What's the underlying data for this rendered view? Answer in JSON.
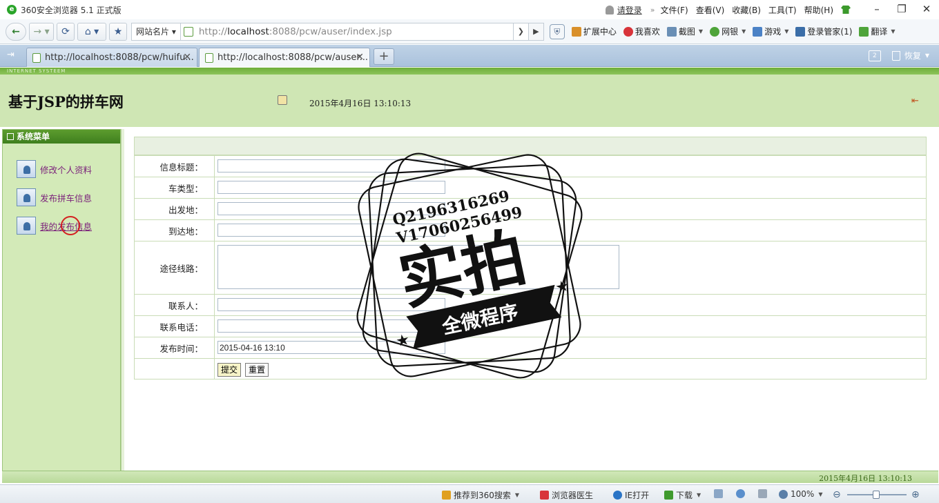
{
  "browser": {
    "title": "360安全浏览器 5.1 正式版",
    "login": "请登录",
    "menus": [
      "文件(F)",
      "查看(V)",
      "收藏(B)",
      "工具(T)",
      "帮助(H)"
    ],
    "site_name": "网站名片",
    "address_prefix": "http://",
    "address_host": "localhost",
    "address_rest": ":8088/pcw/auser/index.jsp",
    "tools": [
      "扩展中心",
      "我喜欢",
      "截图",
      "网银",
      "游戏",
      "登录管家(1)",
      "翻译"
    ],
    "tabs": [
      {
        "label": "http://localhost:8088/pcw/huifu..."
      },
      {
        "label": "http://localhost:8088/pcw/auser..."
      }
    ],
    "tab_count": "2",
    "restore": "恢复",
    "status_items": [
      "推荐到360搜索",
      "浏览器医生",
      "IE打开",
      "下载"
    ],
    "zoom": "100%"
  },
  "page": {
    "banner_small": "INTERNET SYSTEEM",
    "site_title": "基于JSP的拼车网",
    "datetime": "2015年4月16日  13:10:13",
    "footer_datetime": "2015年4月16日  13:10:13",
    "menu_title": "系统菜单",
    "menu_items": [
      "修改个人资料",
      "发布拼车信息",
      "我的发布信息"
    ]
  },
  "form": {
    "labels": {
      "title": "信息标题：",
      "car_type": "车类型：",
      "origin": "出发地：",
      "destination": "到达地：",
      "route": "途径线路：",
      "contact": "联系人：",
      "phone": "联系电话：",
      "publish_time": "发布时间："
    },
    "values": {
      "title": "",
      "car_type": "",
      "origin": "",
      "destination": "",
      "route": "",
      "contact": "",
      "phone": "",
      "publish_time": "2015-04-16 13:10"
    },
    "submit": "提交",
    "reset": "重置"
  },
  "watermark": {
    "line1": "Q2196316269",
    "line2": "V17060256499",
    "big": "实拍",
    "ribbon": "全微程序"
  }
}
